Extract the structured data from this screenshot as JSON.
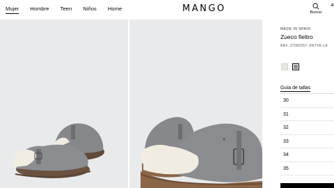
{
  "header": {
    "nav": [
      "Mujer",
      "Hombre",
      "Teen",
      "Niños",
      "Home"
    ],
    "active_nav": "Mujer",
    "logo": "MANGO",
    "search_label": "Buscar"
  },
  "product": {
    "made_in": "MADE IN SPAIN",
    "name": "Zueco fieltro",
    "ref": "REF. 37082557-JINTXE-LA",
    "colors": [
      {
        "name": "cream",
        "hex": "#e8e6de"
      },
      {
        "name": "grey",
        "hex": "#8d8e90",
        "selected": true
      }
    ],
    "size_guide": "Guía de tallas",
    "sizes": [
      "30",
      "31",
      "32",
      "33",
      "34",
      "35"
    ]
  },
  "colors": {
    "gallery_bg": "#e9eaec",
    "felt": "#8a8b8d",
    "shearling": "#efe9dc",
    "cork_sole": "#8a6547"
  }
}
